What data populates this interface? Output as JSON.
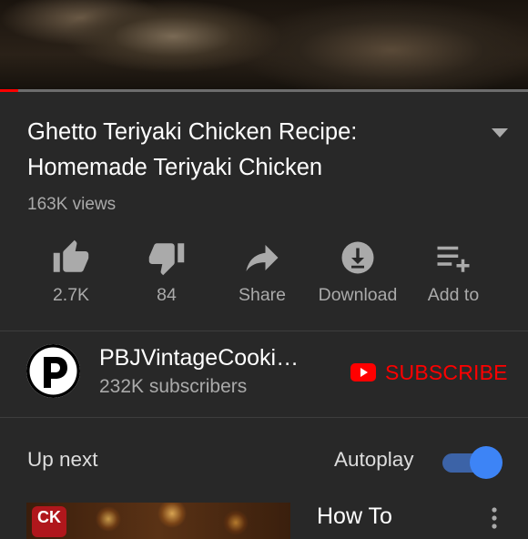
{
  "video": {
    "title": "Ghetto Teriyaki Chicken Recipe: Homemade Teriyaki Chicken",
    "views": "163K views",
    "progress_fraction": 0.035
  },
  "actions": [
    {
      "icon": "thumbs-up-icon",
      "label": "2.7K"
    },
    {
      "icon": "thumbs-down-icon",
      "label": "84"
    },
    {
      "icon": "share-icon",
      "label": "Share"
    },
    {
      "icon": "download-icon",
      "label": "Download"
    },
    {
      "icon": "add-to-playlist-icon",
      "label": "Add to"
    }
  ],
  "channel": {
    "name": "PBJVintageCooki…",
    "subscribers": "232K subscribers",
    "avatar_letter": "P",
    "subscribe_label": "SUBSCRIBE"
  },
  "upnext": {
    "heading": "Up next",
    "autoplay_label": "Autoplay",
    "autoplay_on": true,
    "next_video_title": "How To",
    "next_thumb_badge": "CK"
  },
  "colors": {
    "background": "#282828",
    "accent_red": "#ff0000",
    "toggle_blue": "#3d84f6",
    "secondary_text": "#aaaaaa"
  }
}
